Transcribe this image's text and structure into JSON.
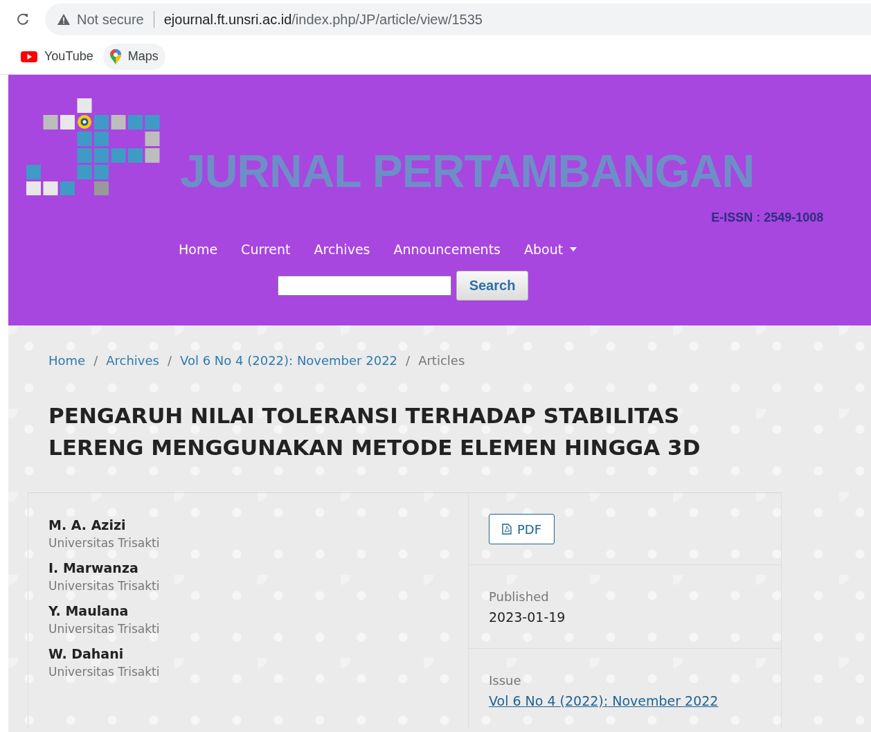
{
  "browser": {
    "security": "Not secure",
    "url_host": "ejournal.ft.unsri.ac.id",
    "url_path": "/index.php/JP/article/view/1535",
    "bookmarks": [
      {
        "label": "YouTube",
        "kind": "youtube"
      },
      {
        "label": "Maps",
        "kind": "maps"
      }
    ]
  },
  "header": {
    "title": "JURNAL PERTAMBANGAN",
    "issn": "E-ISSN : 2549-1008",
    "nav": [
      {
        "label": "Home",
        "dropdown": false
      },
      {
        "label": "Current",
        "dropdown": false
      },
      {
        "label": "Archives",
        "dropdown": false
      },
      {
        "label": "Announcements",
        "dropdown": false
      },
      {
        "label": "About",
        "dropdown": true
      }
    ],
    "search_button": "Search"
  },
  "breadcrumbs": [
    {
      "label": "Home",
      "kind": "link"
    },
    {
      "label": "/",
      "kind": "separator"
    },
    {
      "label": "Archives",
      "kind": "link"
    },
    {
      "label": "/",
      "kind": "separator"
    },
    {
      "label": "Vol 6 No 4 (2022): November 2022",
      "kind": "link"
    },
    {
      "label": "/",
      "kind": "separator"
    },
    {
      "label": "Articles",
      "kind": "current"
    }
  ],
  "article": {
    "title": "PENGARUH NILAI TOLERANSI TERHADAP STABILITAS LERENG MENGGUNAKAN METODE ELEMEN HINGGA 3D",
    "authors": [
      {
        "name": "M. A. Azizi",
        "affiliation": "Universitas Trisakti"
      },
      {
        "name": "I. Marwanza",
        "affiliation": "Universitas Trisakti"
      },
      {
        "name": "Y. Maulana",
        "affiliation": "Universitas Trisakti"
      },
      {
        "name": "W. Dahani",
        "affiliation": "Universitas Trisakti"
      }
    ],
    "galley": "PDF",
    "published_label": "Published",
    "published": "2023-01-19",
    "issue_label": "Issue",
    "issue": "Vol 6 No 4 (2022): November 2022"
  }
}
